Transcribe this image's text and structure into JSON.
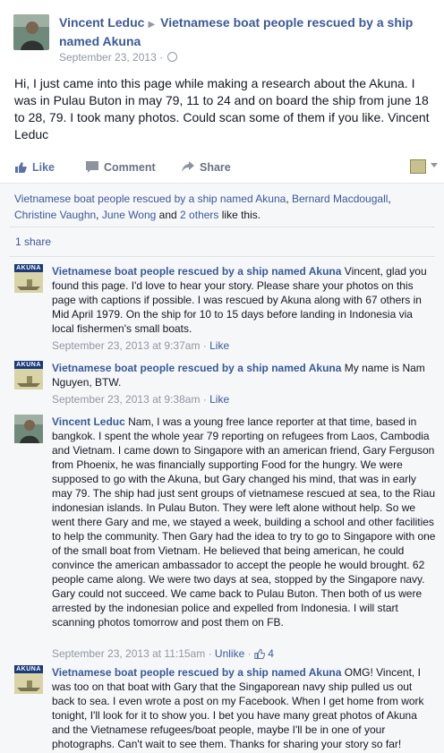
{
  "post": {
    "author": "Vincent Leduc",
    "target": "Vietnamese boat people rescued by a ship named Akuna",
    "date": "September 23, 2013 ·",
    "body": "Hi, I just came into this page while making a research about the Akuna. I was in Pulau Buton in may 79, 11 to 24 and on board the ship from june 18 to 28, 79. I took many photos. Could scan some of them if you like. Vincent Leduc"
  },
  "actions": {
    "like": "Like",
    "comment": "Comment",
    "share": "Share"
  },
  "likes": {
    "page": "Vietnamese boat people rescued by a ship named Akuna",
    "sep1": ", ",
    "person1": "Bernard Macdougall",
    "sep2": ",",
    "person2": "Christine Vaughn",
    "sep3": ", ",
    "person3": "June Wong",
    "and": " and ",
    "others": "2 others",
    "suffix": " like this."
  },
  "shares": "1 share",
  "page_logo_text": "AKUNA",
  "comments": [
    {
      "author": "Vietnamese boat people rescued by a ship named Akuna",
      "text": "Vincent, glad you found this page. I'd love to hear your story. Please share your photos on this page with captions if possible. I was rescued by Akuna along with 67 others in Mid April 1979. On the ship for 10 to 15 days before landing in Indonesia via local fishermen's small boats.",
      "time": "September 23, 2013 at 9:37am",
      "like": "Like"
    },
    {
      "author": "Vietnamese boat people rescued by a ship named Akuna",
      "text": "My name is Nam Nguyen, BTW.",
      "time": "September 23, 2013 at 9:38am",
      "like": "Like"
    },
    {
      "author": "Vincent Leduc",
      "text": "Nam, I was a young free lance reporter at that time, based in bangkok. I spent the whole year 79 reporting on refugees from Laos, Cambodia and Vietnam. I came down to Singapore with an american friend, Gary Ferguson from Phoenix, he was financially supporting Food for the hungry. We were supposed to go with the Akuna, but Gary changed his mind, that was in early may 79. The ship had just sent groups of vietnamese rescued at sea, to the Riau indonesian islands. In Pulau Buton. They were left alone without help. So we went there Gary and me, we stayed a week, building a school and other facilities to help the community. Then Gary had the idea to try to go to Singapore with one of the small boat from Vietnam. He believed that being american, he could convince the american ambassador to accept the people he would brought. 62 people came along. We were two days at sea, stopped by the Singapore navy. Gary could not succeed. We came back to Pulau Buton. Then both of us were arrested by the indonesian police and expelled from Indonesia. I will start scanning photos tomorrow and post them on FB.",
      "time": "September 23, 2013 at 11:15am",
      "like": "Unlike",
      "like_count": "4"
    },
    {
      "author": "Vietnamese boat people rescued by a ship named Akuna",
      "text": "OMG! Vincent, I was too on that boat with Gary that the Singaporean navy ship pulled us out back to sea. I even wrote a post on my Facebook. When I get home from work tonight, I'll look for it to show you. I bet you have many great photos of Akuna and the Vietnamese refugees/boat people, maybe I'll be in one of your photographs. Can't wait to see them. Thanks for sharing your story so far!"
    }
  ],
  "colors": {
    "link": "#3b5998",
    "meta": "#9197a3",
    "ufi_bg": "#f6f7f9"
  }
}
